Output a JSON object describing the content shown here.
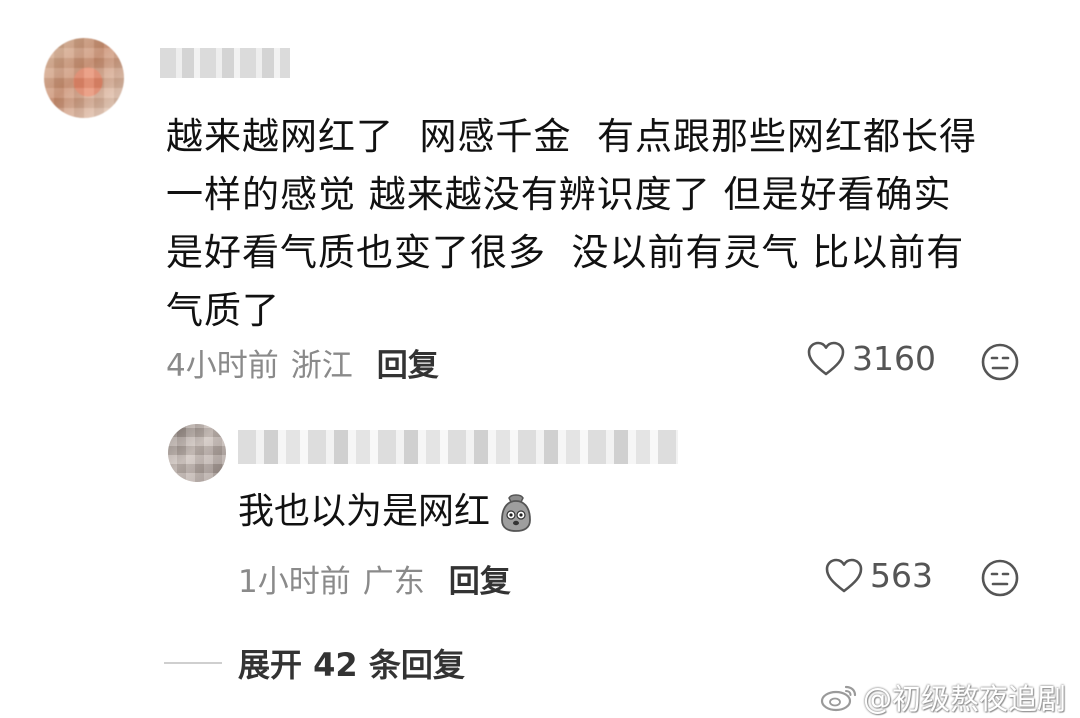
{
  "comment": {
    "text_lines": [
      "越来越网红了  网感千金  有点跟那些网红都长得",
      "一样的感觉 越来越没有辨识度了 但是好看确实",
      "是好看气质也变了很多  没以前有灵气 比以前有",
      "气质了"
    ],
    "time": "4小时前",
    "location": "浙江",
    "reply_label": "回复",
    "likes": "3160"
  },
  "reply": {
    "text": "我也以为是网红",
    "emoji": "bag-face-emoji",
    "time": "1小时前",
    "location": "广东",
    "reply_label": "回复",
    "likes": "563"
  },
  "expand": {
    "label": "展开 42 条回复"
  },
  "watermark": {
    "text": "@初级熬夜追剧"
  },
  "icons": {
    "heart": "heart-icon",
    "dislike": "dislike-face-icon",
    "weibo": "weibo-logo-icon"
  },
  "colors": {
    "text": "#111111",
    "meta": "#8a8a8a",
    "icon": "#555555"
  }
}
